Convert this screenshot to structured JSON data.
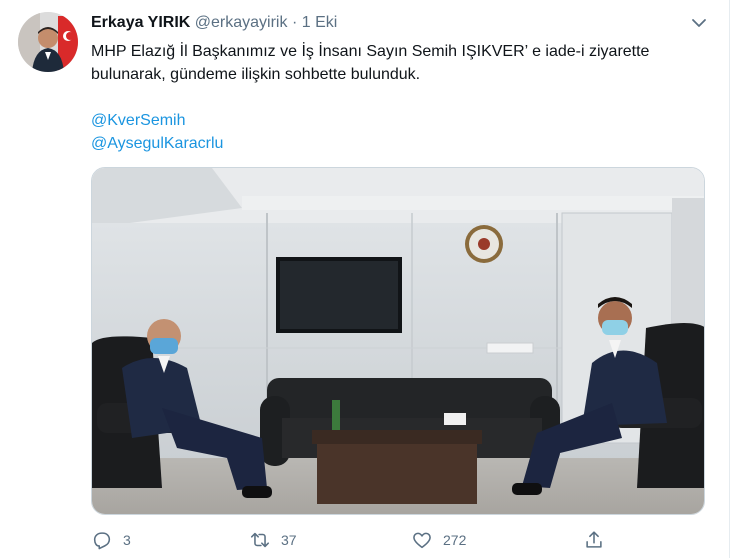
{
  "tweet": {
    "author_name": "Erkaya YIRIK",
    "handle": "@erkayayirik",
    "separator": "·",
    "time": "1 Eki",
    "text_line1": "MHP Elazığ İl Başkanımız ve İş İnsanı Sayın Semih IŞIKVER’ e iade-i ziyarette bulunarak, gündeme ilişkin sohbette bulunduk.",
    "mentions": [
      "@KverSemih",
      "@AysegulKaracrlu"
    ]
  },
  "actions": {
    "reply_count": "3",
    "retweet_count": "37",
    "like_count": "272"
  },
  "icons": {
    "caret": "chevron-down-icon",
    "reply": "reply-icon",
    "retweet": "retweet-icon",
    "like": "heart-icon",
    "share": "share-icon"
  },
  "colors": {
    "link": "#1b95e0",
    "muted": "#5b7083"
  }
}
